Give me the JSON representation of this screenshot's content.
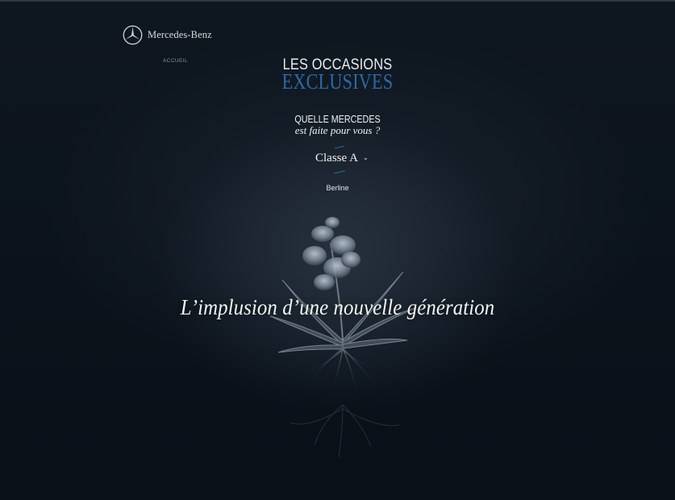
{
  "brand": {
    "name": "Mercedes-Benz"
  },
  "nav": {
    "home_label": "ACCUEIL"
  },
  "hero": {
    "title_line1": "LES OCCASIONS",
    "title_line2": "EXCLUSIVES",
    "question_line1": "QUELLE MERCEDES",
    "question_line2": "est faite pour vous ?"
  },
  "model_selector": {
    "selected": "Classe A",
    "variant": "Berline"
  },
  "tagline": "L’implusion d’une nouvelle génération",
  "colors": {
    "accent": "#2c6aa6",
    "background": "#0b121b",
    "text": "#f0f2f4"
  },
  "icons": {
    "logo": "mercedes-star-icon",
    "dropdown": "chevron-down-icon"
  }
}
